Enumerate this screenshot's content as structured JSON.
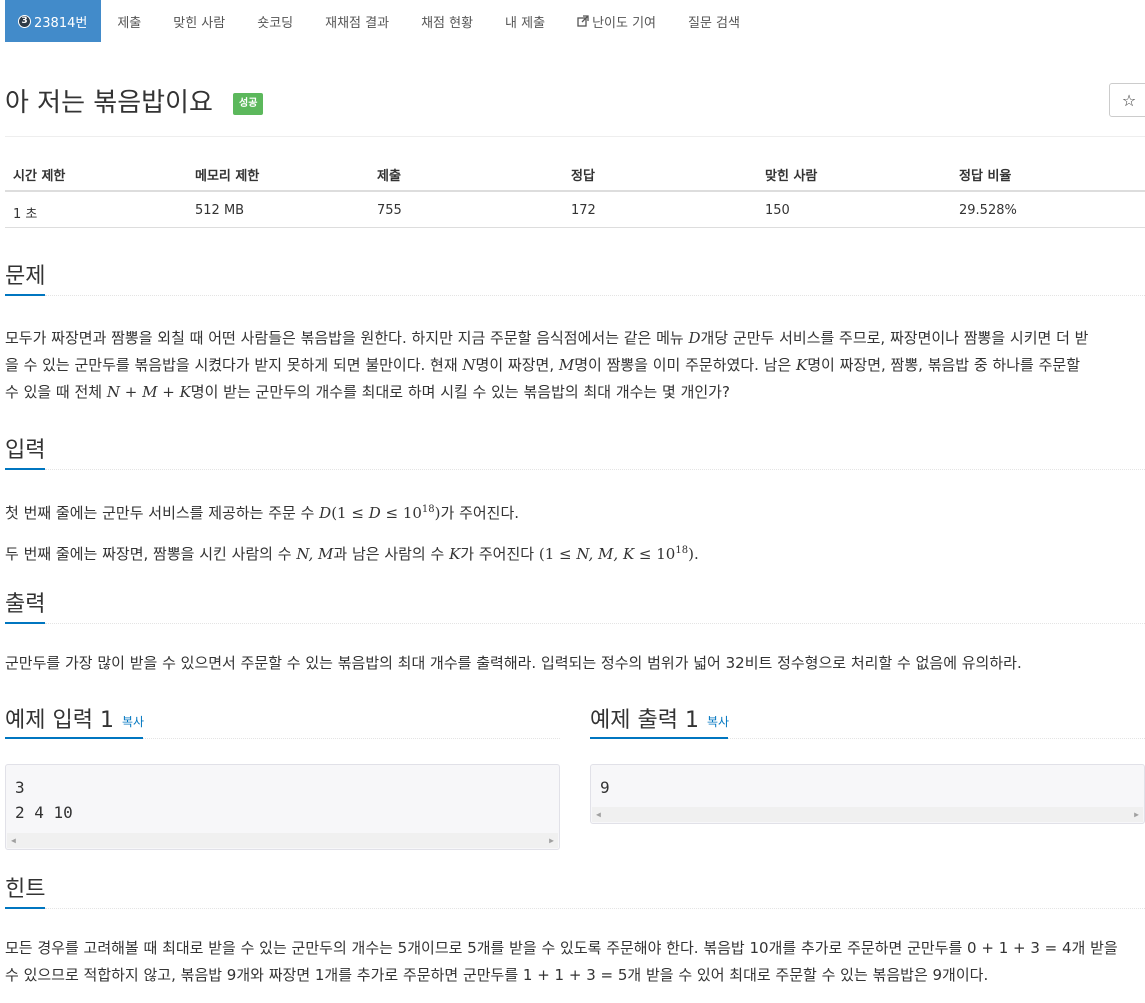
{
  "tabs": [
    {
      "label": "23814번",
      "badge": "3",
      "active": true
    },
    {
      "label": "제출"
    },
    {
      "label": "맞힌 사람"
    },
    {
      "label": "숏코딩"
    },
    {
      "label": "재채점 결과"
    },
    {
      "label": "채점 현황"
    },
    {
      "label": "내 제출"
    },
    {
      "label": "난이도 기여",
      "icon": "external-link-icon"
    },
    {
      "label": "질문 검색"
    }
  ],
  "problem": {
    "title": "아 저는 볶음밥이요",
    "result_label": "성공",
    "result_color": "#5cb85c",
    "star": "☆"
  },
  "info": {
    "headers": [
      "시간 제한",
      "메모리 제한",
      "제출",
      "정답",
      "맞힌 사람",
      "정답 비율"
    ],
    "values": [
      "1 초",
      "512 MB",
      "755",
      "172",
      "150",
      "29.528%"
    ]
  },
  "sections": {
    "problem": {
      "heading": "문제",
      "t1": "모두가 짜장면과 짬뽕을 외칠 때 어떤 사람들은 볶음밥을 원한다. 하지만 지금 주문할 음식점에서는 같은 메뉴 ",
      "D": "D",
      "t2": "개당 군만두 서비스를 주므로, 짜장면이나 짬뽕을 시키면 더 받",
      "t3": "을 수 있는 군만두를 볶음밥을 시켰다가 받지 못하게 되면 불만이다. 현재 ",
      "N": "N",
      "t4": "명이 짜장면, ",
      "M": "M",
      "t5": "명이 짬뽕을 이미 주문하였다. 남은 ",
      "K": "K",
      "t6": "명이 짜장면, 짬뽕, 볶음밥 중 하나를 주문할",
      "t7": "수 있을 때 전체 ",
      "sum": "N + M + K",
      "t8": "명이 받는 군만두의 개수를 최대로 하며 시킬 수 있는 볶음밥의 최대 개수는 몇 개인가?"
    },
    "input": {
      "heading": "입력",
      "l1a": "첫 번째 줄에는 군만두 서비스를 제공하는 주문 수 ",
      "l1m": "D",
      "l1b": "(1 ≤ ",
      "l1c": "D",
      "l1d": " ≤ 10",
      "l1e": "18",
      "l1f": ")",
      "l1g": "가 주어진다.",
      "l2a": "두 번째 줄에는 짜장면, 짬뽕을 시킨 사람의 수 ",
      "l2m": "N, M",
      "l2b": "과 남은 사람의 수 ",
      "l2c": "K",
      "l2d": "가 주어진다 ",
      "l2e": "(1 ≤ ",
      "l2f": "N, M, K",
      "l2g": " ≤ 10",
      "l2h": "18",
      "l2i": ").",
      "l2j": ""
    },
    "output": {
      "heading": "출력",
      "text": "군만두를 가장 많이 받을 수 있으면서 주문할 수 있는 볶음밥의 최대 개수를 출력해라. 입력되는 정수의 범위가 넓어 32비트 정수형으로 처리할 수 없음에 유의하라."
    },
    "sample_input": {
      "heading": "예제 입력 1",
      "copy": "복사",
      "content": "3\n2 4 10"
    },
    "sample_output": {
      "heading": "예제 출력 1",
      "copy": "복사",
      "content": "9"
    },
    "hint": {
      "heading": "힌트",
      "line1": "모든 경우를 고려해볼 때 최대로 받을 수 있는 군만두의 개수는 5개이므로 5개를 받을 수 있도록 주문해야 한다. 볶음밥 10개를 추가로 주문하면 군만두를 0 + 1 + 3 = 4개 받을",
      "line2": "수 있으므로 적합하지 않고, 볶음밥 9개와 짜장면 1개를 추가로 주문하면 군만두를 1 + 1 + 3 = 5개 받을 수 있어 최대로 주문할 수 있는 볶음밥은 9개이다."
    }
  }
}
